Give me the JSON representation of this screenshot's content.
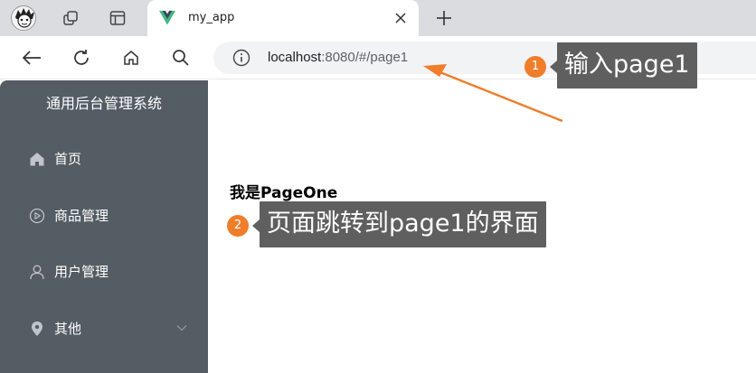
{
  "browser": {
    "tab": {
      "title": "my_app"
    },
    "address_bar": {
      "host": "localhost",
      "rest": ":8080/#/page1"
    },
    "icons": [
      "avatar",
      "tab-groups-icon",
      "sidebar-toggle-icon",
      "vue-favicon-icon",
      "close-icon",
      "plus-icon",
      "back-icon",
      "reload-icon",
      "home-icon",
      "search-icon",
      "info-icon"
    ]
  },
  "sidebar": {
    "title": "通用后台管理系统",
    "items": [
      {
        "label": "首页",
        "icon": "home-icon"
      },
      {
        "label": "商品管理",
        "icon": "video-play-icon"
      },
      {
        "label": "用户管理",
        "icon": "user-icon"
      },
      {
        "label": "其他",
        "icon": "location-icon",
        "expandable": true
      }
    ],
    "colors": {
      "background": "#545c64",
      "text": "#ffffff"
    }
  },
  "main": {
    "heading": "我是PageOne"
  },
  "annotations": [
    {
      "number": "1",
      "text": "输入page1"
    },
    {
      "number": "2",
      "text": "页面跳转到page1的界面"
    }
  ],
  "colors": {
    "annotation_orange": "#ef7d2a",
    "callout_gray": "#5f5f5f"
  }
}
